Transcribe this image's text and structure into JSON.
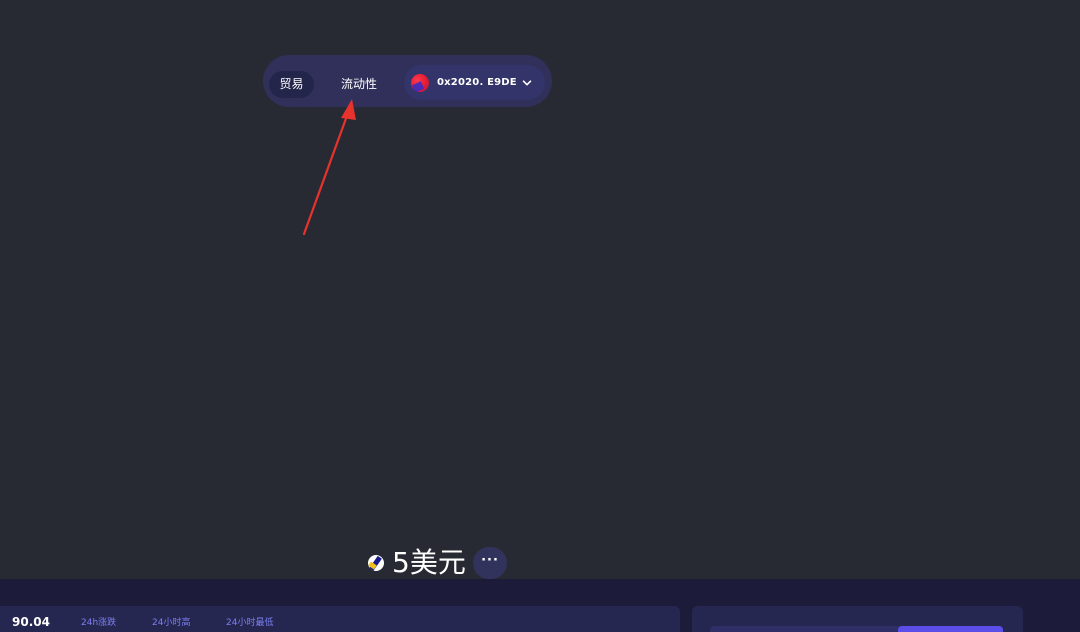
{
  "nav": {
    "trade_label": "贸易",
    "liquidity_label": "流动性",
    "wallet_address": "0x2020. E9DE"
  },
  "token": {
    "price": "5美元",
    "more_label": "···"
  },
  "stats": {
    "price": "90.04",
    "change_label": "24h涨跌",
    "high_label": "24小时高",
    "low_label": "24小时最低"
  },
  "colors": {
    "background": "#282a33",
    "nav_pill": "#30305a",
    "annotation_arrow": "#e8322c",
    "accent": "#5b4ee8",
    "stat_label": "#7b7ff0"
  },
  "icons": {
    "wallet": "wallet-avatar-icon",
    "chevron": "chevron-down-icon",
    "token": "token-logo-icon",
    "more": "more-dots-icon"
  }
}
